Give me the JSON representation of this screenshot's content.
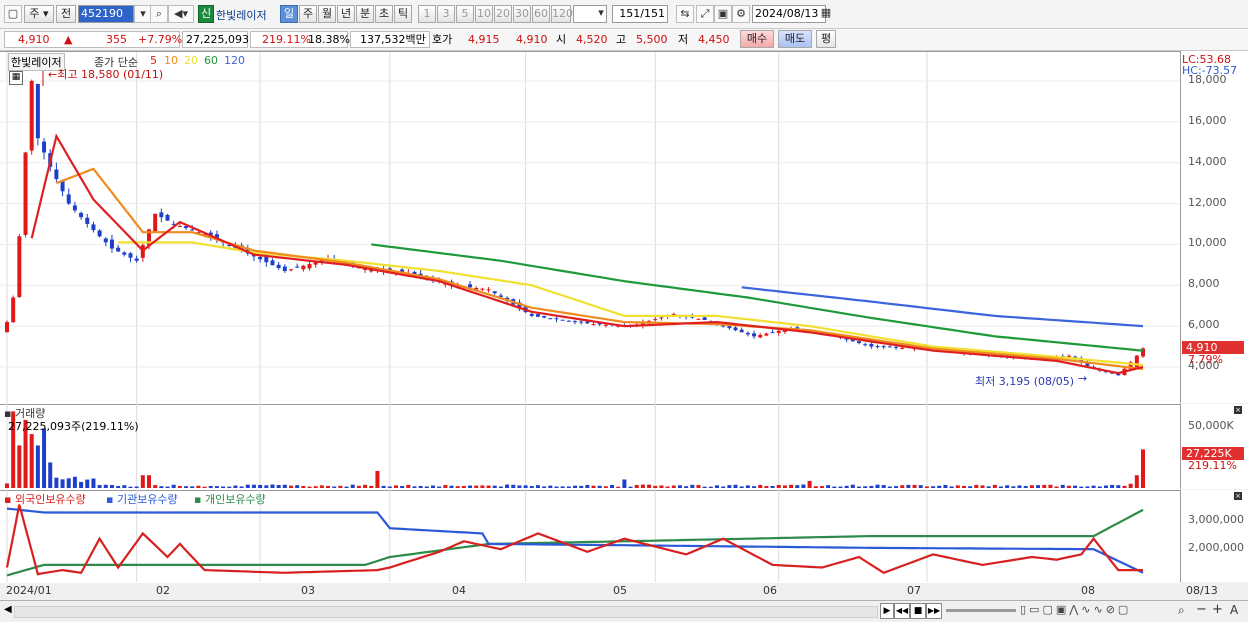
{
  "toolbar": {
    "period_main": "주",
    "prev_label": "전",
    "code_value": "452190",
    "badge_new": "신",
    "stock_name": "한빛레이저",
    "tab_day": "일",
    "tab_week": "주",
    "tab_month": "월",
    "tab_year": "년",
    "tab_min": "분",
    "tab_sec": "초",
    "tab_tick": "틱",
    "intervals": [
      "1",
      "3",
      "5",
      "10",
      "20",
      "30",
      "60",
      "120"
    ],
    "count_value": "151",
    "count_total": "/151",
    "date_value": "2024/08/13"
  },
  "quote": {
    "price": "4,910",
    "change_arrow": "▲",
    "change": "355",
    "change_pct": "+7.79%",
    "volume": "27,225,093",
    "vol_ratio": "219.11%",
    "turnover": "18.38%",
    "amount": "137,532백만",
    "hoga_label": "호가",
    "hoga_ask": "4,915",
    "hoga_bid": "4,910",
    "open_label": "시",
    "open": "4,520",
    "high_label": "고",
    "high": "5,500",
    "low_label": "저",
    "low": "4,450",
    "buy_btn": "매수",
    "sell_btn": "매도",
    "eval_btn": "평"
  },
  "price_panel": {
    "name_tag": "한빛레이저",
    "legend_prefix": "종가 단순",
    "ma_periods": [
      "5",
      "10",
      "20",
      "60",
      "120"
    ],
    "ma_colors": [
      "#e02020",
      "#f08c1e",
      "#f0e030",
      "#1e9a3a",
      "#3c64dc"
    ],
    "high_note": "←최고 18,580 (01/11)",
    "low_note": "최저 3,195 (08/05)",
    "lc": "LC:53.68",
    "hc": "HC:-73.57",
    "y_ticks": [
      "18,000",
      "16,000",
      "14,000",
      "12,000",
      "10,000",
      "8,000",
      "6,000",
      "4,000"
    ],
    "last_price_tag": "4,910",
    "last_pct_tag": "7.79%"
  },
  "volume_panel": {
    "title": "거래량",
    "value_note": "27,225,093주(219.11%)",
    "y_tick": "50,000K",
    "last_tag": "27,225K",
    "last_pct": "219.11%"
  },
  "holding_panel": {
    "legend": [
      "외국인보유수량",
      "기관보유수량",
      "개인보유수량"
    ],
    "colors": [
      "#d82020",
      "#2a5ad8",
      "#2e8a4a"
    ],
    "y_ticks": [
      "3,000,000",
      "2,000,000"
    ]
  },
  "x_axis": {
    "labels": [
      "2024/01",
      "02",
      "03",
      "04",
      "05",
      "06",
      "07",
      "08",
      "08/13"
    ]
  },
  "chart_data": {
    "type": "candlestick",
    "price_ylim": [
      3000,
      18580
    ],
    "months": [
      "2024/01",
      "02",
      "03",
      "04",
      "05",
      "06",
      "07",
      "08"
    ],
    "close_anchors": [
      [
        0,
        6200
      ],
      [
        1,
        7400
      ],
      [
        2,
        10400
      ],
      [
        3,
        14500
      ],
      [
        4,
        18000
      ],
      [
        5,
        15200
      ],
      [
        7,
        13800
      ],
      [
        10,
        12000
      ],
      [
        13,
        11000
      ],
      [
        17,
        9800
      ],
      [
        21,
        9200
      ],
      [
        24,
        11500
      ],
      [
        27,
        11000
      ],
      [
        32,
        10500
      ],
      [
        38,
        9700
      ],
      [
        45,
        8700
      ],
      [
        52,
        9300
      ],
      [
        58,
        8800
      ],
      [
        65,
        8600
      ],
      [
        72,
        8000
      ],
      [
        78,
        7800
      ],
      [
        85,
        6500
      ],
      [
        95,
        6100
      ],
      [
        101,
        6000
      ],
      [
        108,
        6600
      ],
      [
        113,
        6300
      ],
      [
        121,
        5500
      ],
      [
        127,
        5900
      ],
      [
        133,
        5600
      ],
      [
        140,
        5000
      ],
      [
        149,
        4900
      ],
      [
        158,
        4600
      ],
      [
        166,
        4400
      ],
      [
        172,
        4550
      ],
      [
        176,
        3900
      ],
      [
        180,
        3600
      ],
      [
        183,
        4555
      ],
      [
        184,
        4910
      ]
    ],
    "ma5": [
      [
        4,
        10300
      ],
      [
        8,
        15300
      ],
      [
        14,
        12200
      ],
      [
        22,
        9700
      ],
      [
        28,
        11100
      ],
      [
        40,
        9500
      ],
      [
        55,
        9000
      ],
      [
        70,
        8200
      ],
      [
        85,
        6700
      ],
      [
        100,
        6000
      ],
      [
        115,
        6200
      ],
      [
        130,
        5700
      ],
      [
        150,
        4800
      ],
      [
        170,
        4300
      ],
      [
        180,
        3700
      ],
      [
        184,
        4000
      ]
    ],
    "ma10": [
      [
        8,
        13000
      ],
      [
        14,
        13700
      ],
      [
        22,
        10600
      ],
      [
        30,
        10600
      ],
      [
        40,
        9700
      ],
      [
        55,
        9100
      ],
      [
        70,
        8300
      ],
      [
        85,
        6900
      ],
      [
        100,
        6200
      ],
      [
        115,
        6100
      ],
      [
        130,
        5800
      ],
      [
        150,
        4900
      ],
      [
        170,
        4400
      ],
      [
        184,
        3900
      ]
    ],
    "ma20": [
      [
        18,
        10100
      ],
      [
        30,
        10100
      ],
      [
        40,
        9600
      ],
      [
        55,
        9200
      ],
      [
        70,
        8700
      ],
      [
        85,
        8000
      ],
      [
        100,
        6500
      ],
      [
        115,
        6500
      ],
      [
        130,
        6000
      ],
      [
        150,
        5000
      ],
      [
        170,
        4500
      ],
      [
        184,
        4100
      ]
    ],
    "ma60": [
      [
        59,
        10000
      ],
      [
        80,
        9200
      ],
      [
        100,
        8200
      ],
      [
        120,
        7400
      ],
      [
        140,
        6400
      ],
      [
        160,
        5500
      ],
      [
        184,
        4800
      ]
    ],
    "ma120": [
      [
        119,
        7900
      ],
      [
        140,
        7200
      ],
      [
        160,
        6500
      ],
      [
        184,
        6000
      ]
    ],
    "volume_max": 55000,
    "volume_unit": "K",
    "volume_last": 27225,
    "holdings": {
      "ylim": [
        800000,
        3700000
      ],
      "institution": [
        [
          0,
          3450000
        ],
        [
          6,
          3300000
        ],
        [
          60,
          3300000
        ],
        [
          62,
          2700000
        ],
        [
          77,
          2500000
        ],
        [
          78,
          2100000
        ],
        [
          100,
          2050000
        ],
        [
          140,
          1950000
        ],
        [
          176,
          1900000
        ],
        [
          184,
          1000000
        ]
      ],
      "individual": [
        [
          0,
          900000
        ],
        [
          6,
          1300000
        ],
        [
          58,
          1300000
        ],
        [
          62,
          1600000
        ],
        [
          78,
          2100000
        ],
        [
          100,
          2200000
        ],
        [
          140,
          2400000
        ],
        [
          176,
          2400000
        ],
        [
          184,
          3400000
        ]
      ],
      "foreign": [
        [
          0,
          1200000
        ],
        [
          2,
          3600000
        ],
        [
          5,
          950000
        ],
        [
          9,
          1100000
        ],
        [
          12,
          1000000
        ],
        [
          15,
          2300000
        ],
        [
          18,
          1200000
        ],
        [
          22,
          2500000
        ],
        [
          26,
          1600000
        ],
        [
          28,
          2100000
        ],
        [
          32,
          1100000
        ],
        [
          45,
          1000000
        ],
        [
          60,
          1100000
        ],
        [
          62,
          1200000
        ],
        [
          70,
          1800000
        ],
        [
          74,
          2200000
        ],
        [
          80,
          1900000
        ],
        [
          86,
          2500000
        ],
        [
          94,
          1800000
        ],
        [
          100,
          2300000
        ],
        [
          110,
          1700000
        ],
        [
          116,
          2300000
        ],
        [
          124,
          1300000
        ],
        [
          132,
          1200000
        ],
        [
          138,
          1600000
        ],
        [
          142,
          1000000
        ],
        [
          150,
          1700000
        ],
        [
          158,
          1300000
        ],
        [
          166,
          1600000
        ],
        [
          170,
          1500000
        ],
        [
          174,
          1700000
        ],
        [
          176,
          2300000
        ],
        [
          180,
          1100000
        ],
        [
          184,
          1100000
        ]
      ]
    }
  }
}
